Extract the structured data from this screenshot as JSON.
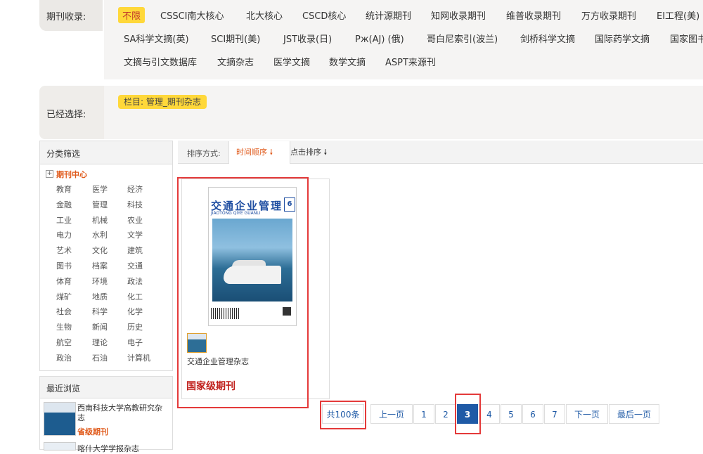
{
  "filter": {
    "label": "期刊收录:",
    "tags_row1": [
      "不限",
      "CSSCI南大核心",
      "北大核心",
      "CSCD核心",
      "统计源期刊",
      "知网收录期刊",
      "维普收录期刊",
      "万方收录期刊",
      "EI工程(美)"
    ],
    "tags_row2": [
      "SA科学文摘(英)",
      "SCI期刊(美)",
      "JST收录(日)",
      "Рж(AJ) (俄)",
      "哥白尼索引(波兰)",
      "剑桥科学文摘",
      "国际药学文摘",
      "国家图书"
    ],
    "tags_row3": [
      "文摘与引文数据库",
      "文摘杂志",
      "医学文摘",
      "数学文摘",
      "ASPT来源刊"
    ],
    "active_index": 0
  },
  "selected": {
    "label": "已经选择:",
    "chip": "栏目: 管理_期刊杂志"
  },
  "sidebar": {
    "title": "分类筛选",
    "root": "期刊中心",
    "toggle": "+",
    "categories": [
      "教育",
      "医学",
      "经济",
      "金融",
      "管理",
      "科技",
      "工业",
      "机械",
      "农业",
      "电力",
      "水利",
      "文学",
      "艺术",
      "文化",
      "建筑",
      "图书",
      "档案",
      "交通",
      "体育",
      "环境",
      "政法",
      "煤矿",
      "地质",
      "化工",
      "社会",
      "科学",
      "化学",
      "生物",
      "新闻",
      "历史",
      "航空",
      "理论",
      "电子",
      "政治",
      "石油",
      "计算机"
    ]
  },
  "recent": {
    "title": "最近浏览",
    "items": [
      {
        "name": "西南科技大学高教研究杂志",
        "level": "省级期刊"
      },
      {
        "name": "喀什大学学报杂志",
        "level": ""
      }
    ]
  },
  "sort": {
    "label": "排序方式:",
    "options": [
      {
        "label": "时间顺序",
        "arrow": "🠗",
        "active": true
      },
      {
        "label": "点击排序",
        "arrow": "🠗",
        "active": false
      }
    ]
  },
  "results": [
    {
      "name": "交通企业管理杂志",
      "level": "国家级期刊",
      "cover_title": "交通企业管理",
      "cover_subtitle": "JIAOTONG QIYE GUANLI",
      "cover_issue": "6"
    }
  ],
  "pagination": {
    "total": "共100条",
    "prev": "上一页",
    "pages": [
      "1",
      "2",
      "3",
      "4",
      "5",
      "6",
      "7"
    ],
    "current": "3",
    "next": "下一页",
    "last": "最后一页"
  },
  "colors": {
    "accent_orange": "#e05a1b",
    "chip_yellow": "#ffd83a",
    "link_blue": "#1f5aa6",
    "level_red": "#c0201c",
    "highlight_red": "#e43a3a"
  }
}
